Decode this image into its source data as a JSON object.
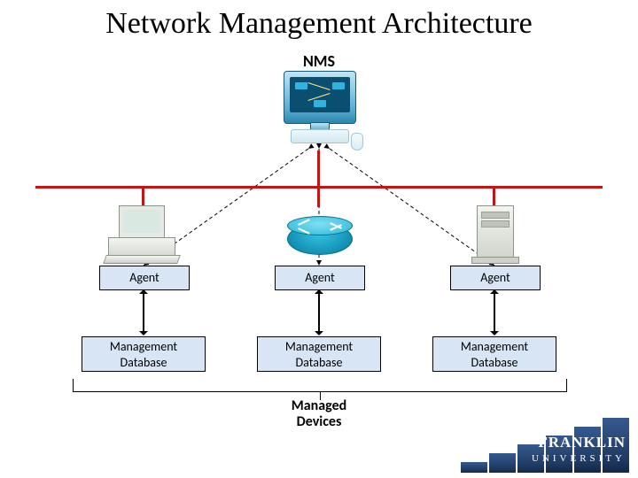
{
  "title": "Network Management Architecture",
  "nms_label": "NMS",
  "columns": [
    {
      "device_type": "workstation",
      "agent_label": "Agent",
      "db_label": "Management\nDatabase"
    },
    {
      "device_type": "router",
      "agent_label": "Agent",
      "db_label": "Management\nDatabase"
    },
    {
      "device_type": "server",
      "agent_label": "Agent",
      "db_label": "Management\nDatabase"
    }
  ],
  "footer_label": "Managed\nDevices",
  "logo": {
    "name": "FRANKLIN",
    "sub": "UNIVERSITY"
  },
  "colors": {
    "net_line": "#c41414",
    "box_fill": "#d7e5f4",
    "logo_blue": "#1f3a63"
  }
}
